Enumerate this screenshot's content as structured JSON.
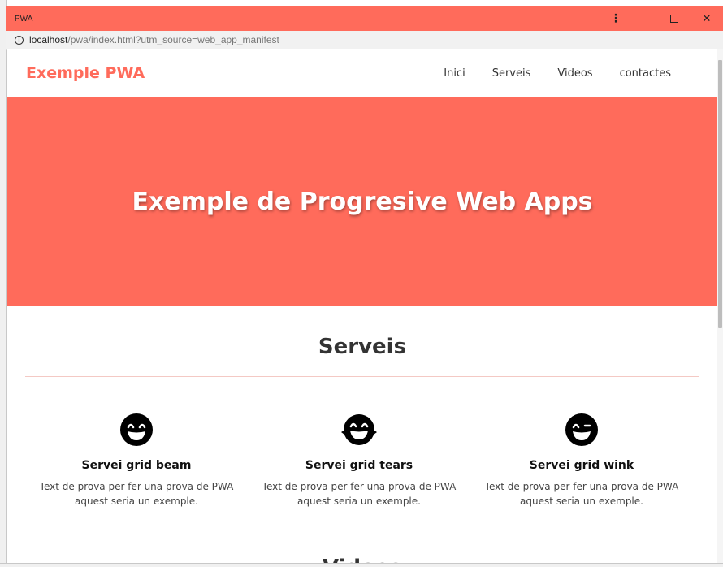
{
  "window": {
    "title": "PWA",
    "menu_icon": "vertical-dots-icon",
    "minimize_icon": "minimize-icon",
    "maximize_icon": "maximize-icon",
    "close_glyph": "✕"
  },
  "urlbar": {
    "host": "localhost",
    "path": "/pwa/index.html?utm_source=web_app_manifest",
    "icon": "info-icon"
  },
  "nav": {
    "brand": "Exemple PWA",
    "links": [
      "Inici",
      "Serveis",
      "Videos",
      "contactes"
    ]
  },
  "hero": {
    "title": "Exemple de Progresive Web Apps"
  },
  "services": {
    "title": "Serveis",
    "items": [
      {
        "title": "Servei grid beam",
        "text": "Text de prova per fer una prova de PWA aquest seria un exemple.",
        "icon": "grin-beam-icon"
      },
      {
        "title": "Servei grid tears",
        "text": "Text de prova per fer una prova de PWA aquest seria un exemple.",
        "icon": "grin-tears-icon"
      },
      {
        "title": "Servei grid wink",
        "text": "Text de prova per fer una prova de PWA aquest seria un exemple.",
        "icon": "grin-wink-icon"
      }
    ]
  },
  "next_section": {
    "title": "Videos"
  },
  "colors": {
    "accent": "#ff6b5b",
    "text": "#333333"
  }
}
